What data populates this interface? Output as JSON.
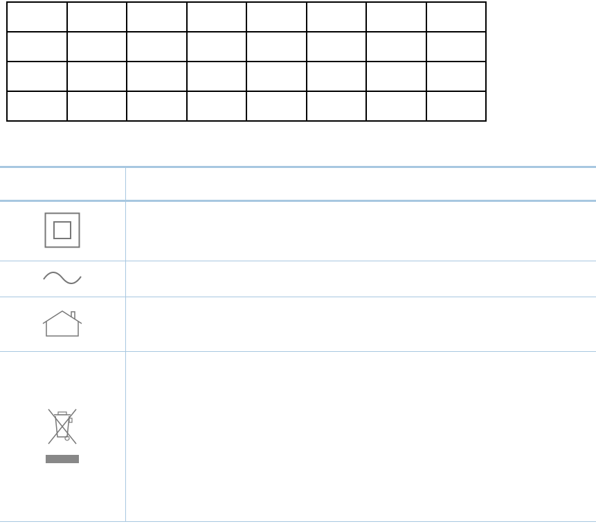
{
  "grid": {
    "rows": [
      [
        "",
        "",
        "",
        "",
        "",
        "",
        "",
        ""
      ],
      [
        "",
        "",
        "",
        "",
        "",
        "",
        "",
        ""
      ],
      [
        "",
        "",
        "",
        "",
        "",
        "",
        "",
        ""
      ],
      [
        "",
        "",
        "",
        "",
        "",
        "",
        "",
        ""
      ]
    ]
  },
  "symbol_table": {
    "header": {
      "symbol": "",
      "description": ""
    },
    "rows": [
      {
        "icon": "double-insulation-icon",
        "description": ""
      },
      {
        "icon": "alternating-current-icon",
        "description": ""
      },
      {
        "icon": "indoor-use-house-icon",
        "description": ""
      },
      {
        "icon": "weee-crossed-bin-icon",
        "description": ""
      }
    ]
  },
  "colors": {
    "grid_border": "#000000",
    "table_rule": "#a7c7e0",
    "icon_stroke": "#777777"
  }
}
